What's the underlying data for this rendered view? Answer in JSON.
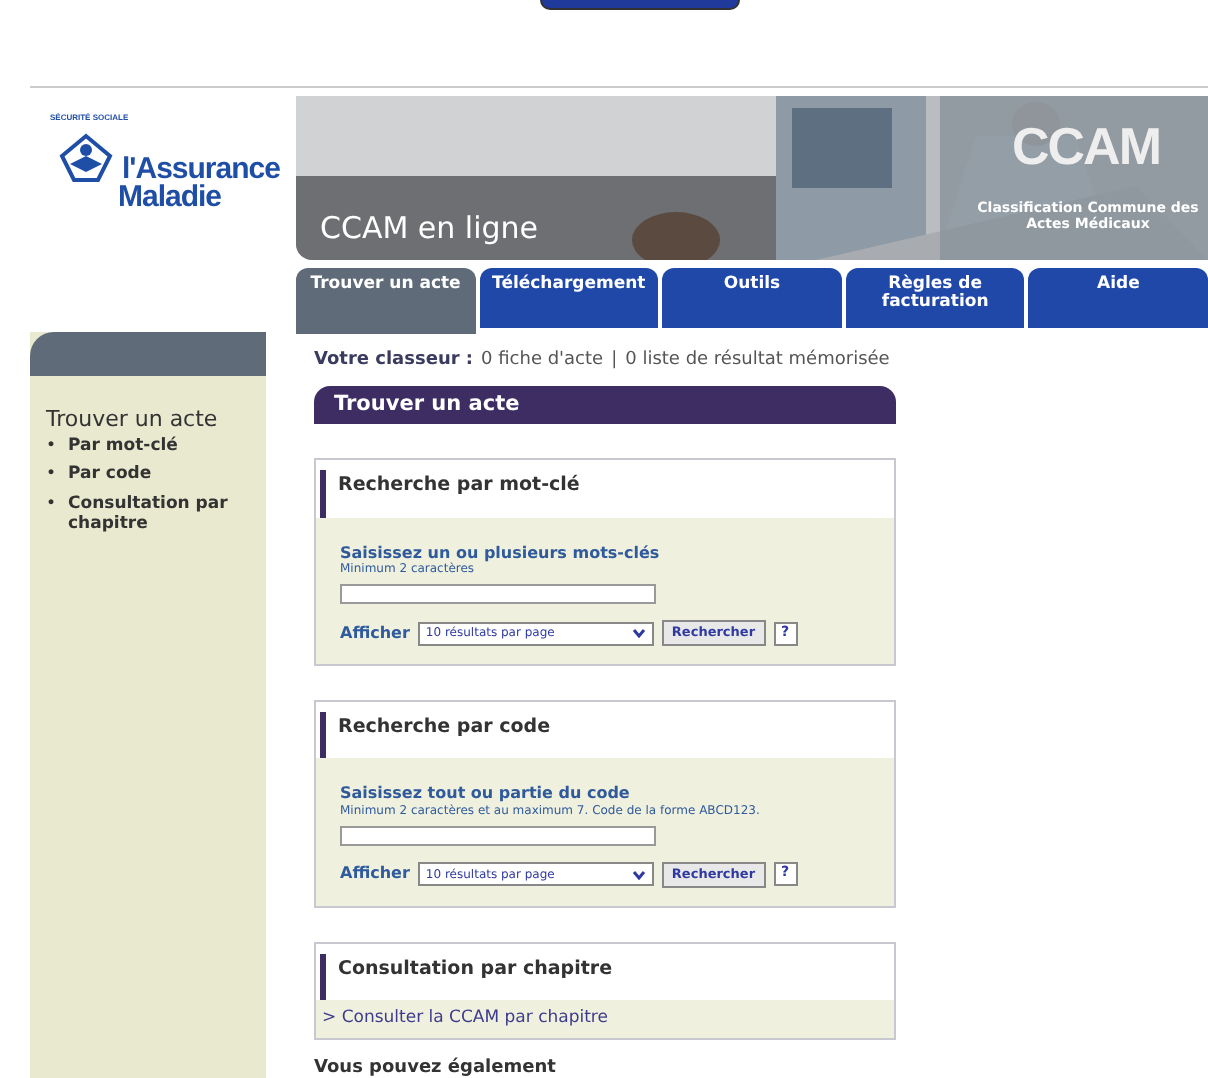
{
  "logo": {
    "arc_text": "SÉCURITÉ SOCIALE",
    "line_1": "l'Assurance",
    "line_2": "Maladie"
  },
  "banner": {
    "kind": "picture",
    "title": "CCAM en ligne",
    "acronym": "CCAM",
    "subtitle": "Classification Commune des Actes Médicaux"
  },
  "tabs": [
    {
      "label": "Trouver un acte",
      "selected": true
    },
    {
      "label": "Téléchargement",
      "selected": false
    },
    {
      "label": "Outils",
      "selected": false
    },
    {
      "label": "Règles de facturation",
      "selected": false
    },
    {
      "label": "Aide",
      "selected": false
    }
  ],
  "sidebar": {
    "title": "Trouver un acte",
    "items": [
      {
        "bullet": "•",
        "label": "Par mot-clé"
      },
      {
        "bullet": "•",
        "label": "Par code"
      },
      {
        "bullet": "•",
        "label": "Consultation par chapitre"
      }
    ]
  },
  "classeur": {
    "label": "Votre classeur :",
    "fiches": "0 fiche d'acte",
    "separator": "|",
    "listes": "0 liste de résultat mémorisée"
  },
  "section_title": "Trouver un acte",
  "panels": [
    {
      "kind": "search",
      "title": "Recherche par mot-clé",
      "label": "Saisissez un ou plusieurs mots-clés",
      "hint": "Minimum 2 caractères",
      "show_label": "Afficher",
      "select": "10 résultats par page",
      "button": "Rechercher",
      "help": "?"
    },
    {
      "kind": "search",
      "title": "Recherche par code",
      "label": "Saisissez tout ou partie du code",
      "hint": "Minimum 2 caractères et au maximum 7. Code de la forme ABCD123.",
      "show_label": "Afficher",
      "select": "10 résultats par page",
      "button": "Rechercher",
      "help": "?"
    },
    {
      "kind": "link",
      "title": "Consultation par chapitre",
      "link": "> Consulter la CCAM par chapitre"
    }
  ],
  "footer_text": "Vous pouvez également"
}
